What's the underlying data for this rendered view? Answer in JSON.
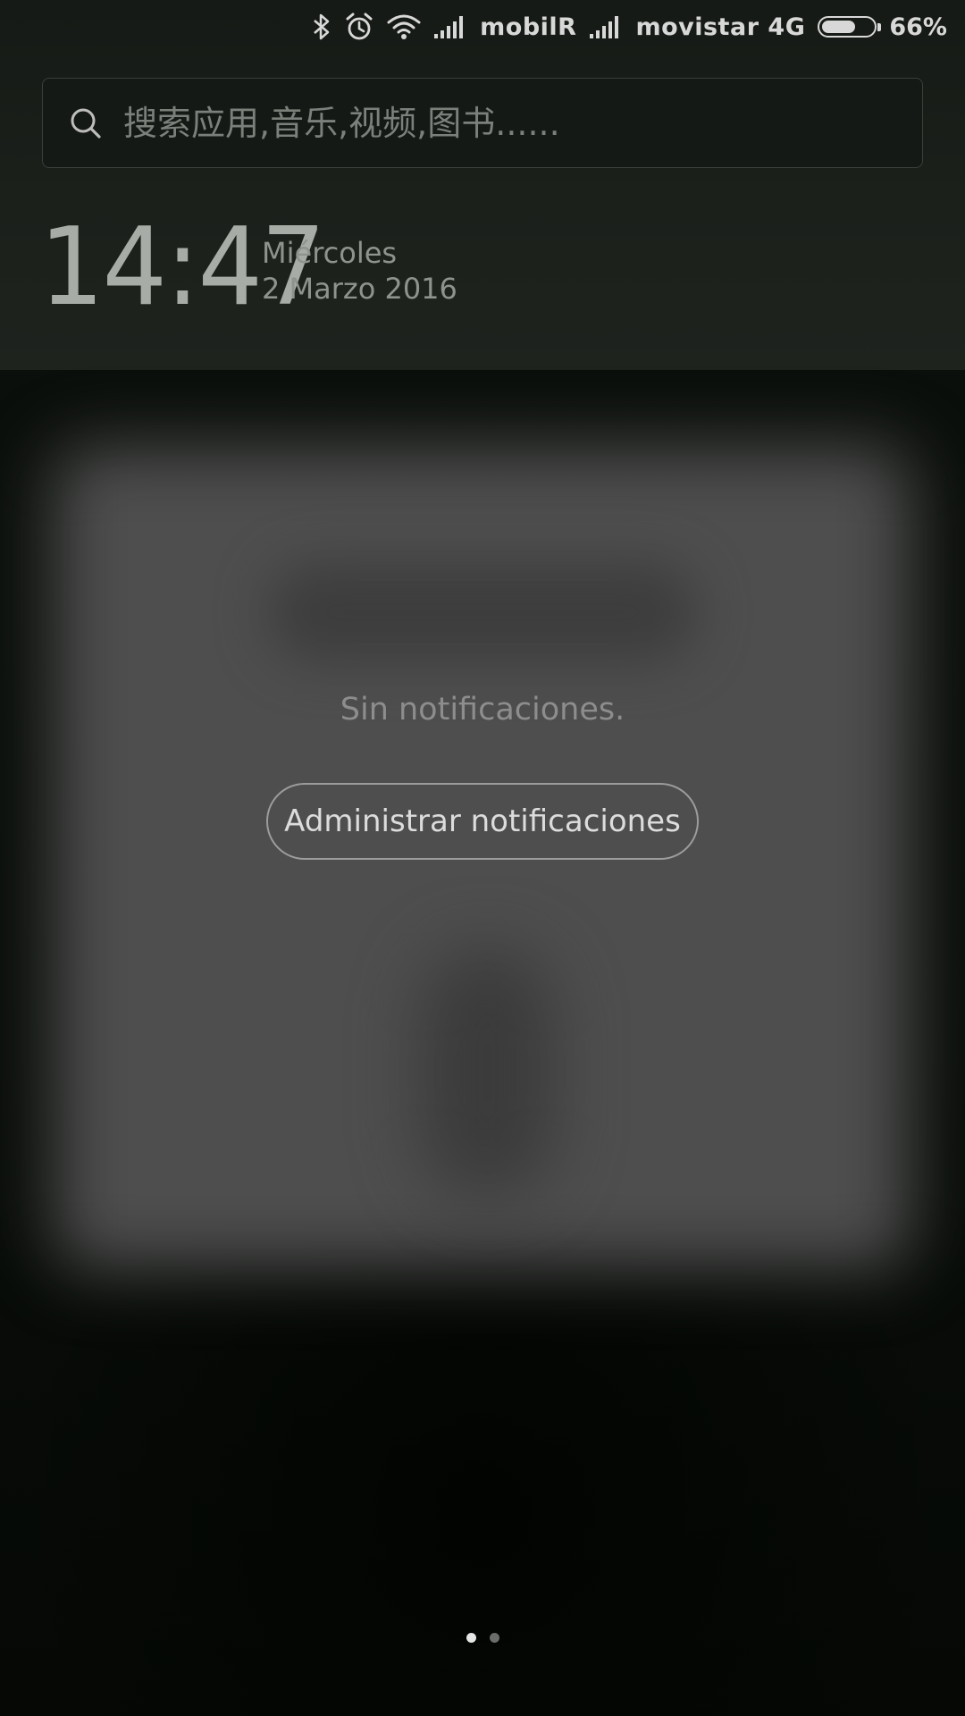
{
  "status_bar": {
    "icons": [
      "bluetooth-icon",
      "alarm-icon",
      "wifi-icon",
      "signal-icon",
      "signal-icon"
    ],
    "carrier_1": "mobilR",
    "carrier_2": "movistar 4G",
    "battery_level": 0.66,
    "battery_text": "66%"
  },
  "search": {
    "placeholder": "搜索应用,音乐,视频,图书......",
    "value": ""
  },
  "clock": {
    "hours": "14",
    "separator": ":",
    "minutes": "47",
    "weekday": "Miércoles",
    "date": "2 Marzo 2016"
  },
  "notifications": {
    "empty_text": "Sin notificaciones.",
    "manage_label": "Administrar notificaciones"
  },
  "pager": {
    "page_count": 2,
    "active_page": 1
  },
  "colors": {
    "accent_text": "#dcdcdc",
    "background": "#0a0e0a"
  }
}
